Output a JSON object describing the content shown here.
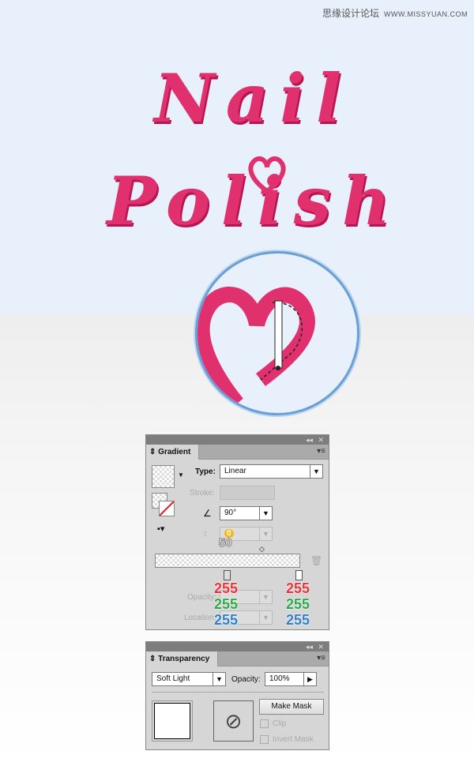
{
  "watermark": {
    "site": "思缘设计论坛",
    "url": "WWW.MISSYUAN.COM"
  },
  "artwork": {
    "line1": "Nail",
    "line2": "Polish"
  },
  "gradient_panel": {
    "title": "Gradient",
    "type_label": "Type:",
    "type_value": "Linear",
    "stroke_label": "Stroke:",
    "angle_value": "90°",
    "aspect_badge": "0",
    "midpoint_annotation": "50",
    "opacity_label": "Opacity:",
    "location_label": "Location:",
    "stops": [
      {
        "r": "255",
        "g": "255",
        "b": "255"
      },
      {
        "r": "255",
        "g": "255",
        "b": "255"
      }
    ],
    "colors": {
      "red": "#e8333a",
      "green": "#2fa84a",
      "blue": "#2f7fc8"
    }
  },
  "transparency_panel": {
    "title": "Transparency",
    "blend_mode": "Soft Light",
    "opacity_label": "Opacity:",
    "opacity_value": "100%",
    "make_mask": "Make Mask",
    "clip": "Clip",
    "invert_mask": "Invert Mask"
  }
}
